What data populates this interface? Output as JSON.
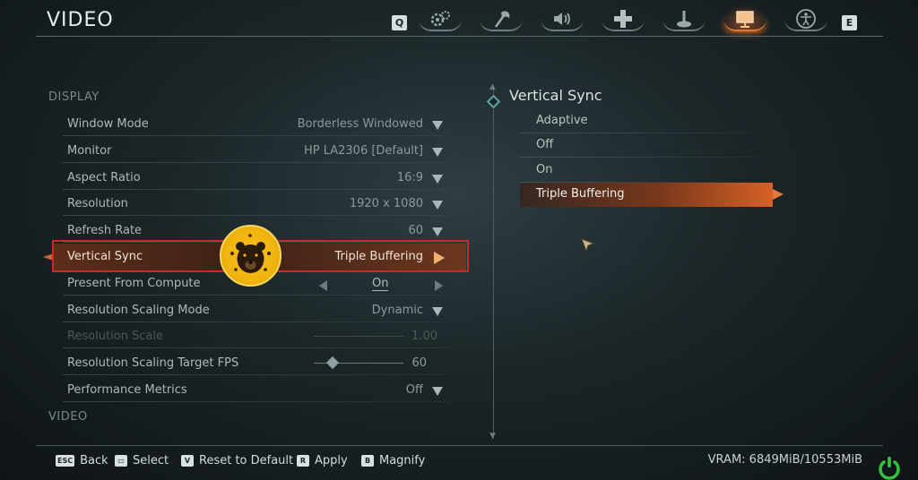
{
  "header": {
    "title": "VIDEO",
    "prev_key": "Q",
    "next_key": "E",
    "tabs": [
      {
        "icon": "gears-icon",
        "label": "Game"
      },
      {
        "icon": "axe-icon",
        "label": "Gameplay"
      },
      {
        "icon": "speaker-icon",
        "label": "Audio"
      },
      {
        "icon": "dpad-icon",
        "label": "Controls"
      },
      {
        "icon": "joystick-icon",
        "label": "Controller"
      },
      {
        "icon": "monitor-icon",
        "label": "Video"
      },
      {
        "icon": "accessibility-icon",
        "label": "Accessibility"
      }
    ],
    "active_tab": "Video"
  },
  "settings": {
    "section_display": "DISPLAY",
    "section_video": "VIDEO",
    "rows": [
      {
        "label": "Window Mode",
        "value": "Borderless Windowed"
      },
      {
        "label": "Monitor",
        "value": "HP LA2306 [Default]"
      },
      {
        "label": "Aspect Ratio",
        "value": "16:9"
      },
      {
        "label": "Resolution",
        "value": "1920 x 1080"
      },
      {
        "label": "Refresh Rate",
        "value": "60"
      },
      {
        "label": "Vertical Sync",
        "value": "Triple Buffering"
      },
      {
        "label": "Present From Compute",
        "value": "On"
      },
      {
        "label": "Resolution Scaling Mode",
        "value": "Dynamic"
      },
      {
        "label": "Resolution Scale",
        "value": "1.00"
      },
      {
        "label": "Resolution Scaling Target FPS",
        "value": "60"
      },
      {
        "label": "Performance Metrics",
        "value": "Off"
      }
    ]
  },
  "detail": {
    "title": "Vertical Sync",
    "options": [
      "Adaptive",
      "Off",
      "On",
      "Triple Buffering"
    ],
    "selected": "Triple Buffering"
  },
  "footer": {
    "buttons": [
      {
        "key": "ESC",
        "label": "Back"
      },
      {
        "key": "▭",
        "label": "Select"
      },
      {
        "key": "V",
        "label": "Reset to Default"
      },
      {
        "key": "R",
        "label": "Apply"
      },
      {
        "key": "B",
        "label": "Magnify"
      }
    ],
    "vram": "VRAM: 6849MiB/10553MiB"
  },
  "colors": {
    "accent": "#e07a2e",
    "highlight_frame": "#d42426",
    "logo_fill": "#f2b40f"
  }
}
